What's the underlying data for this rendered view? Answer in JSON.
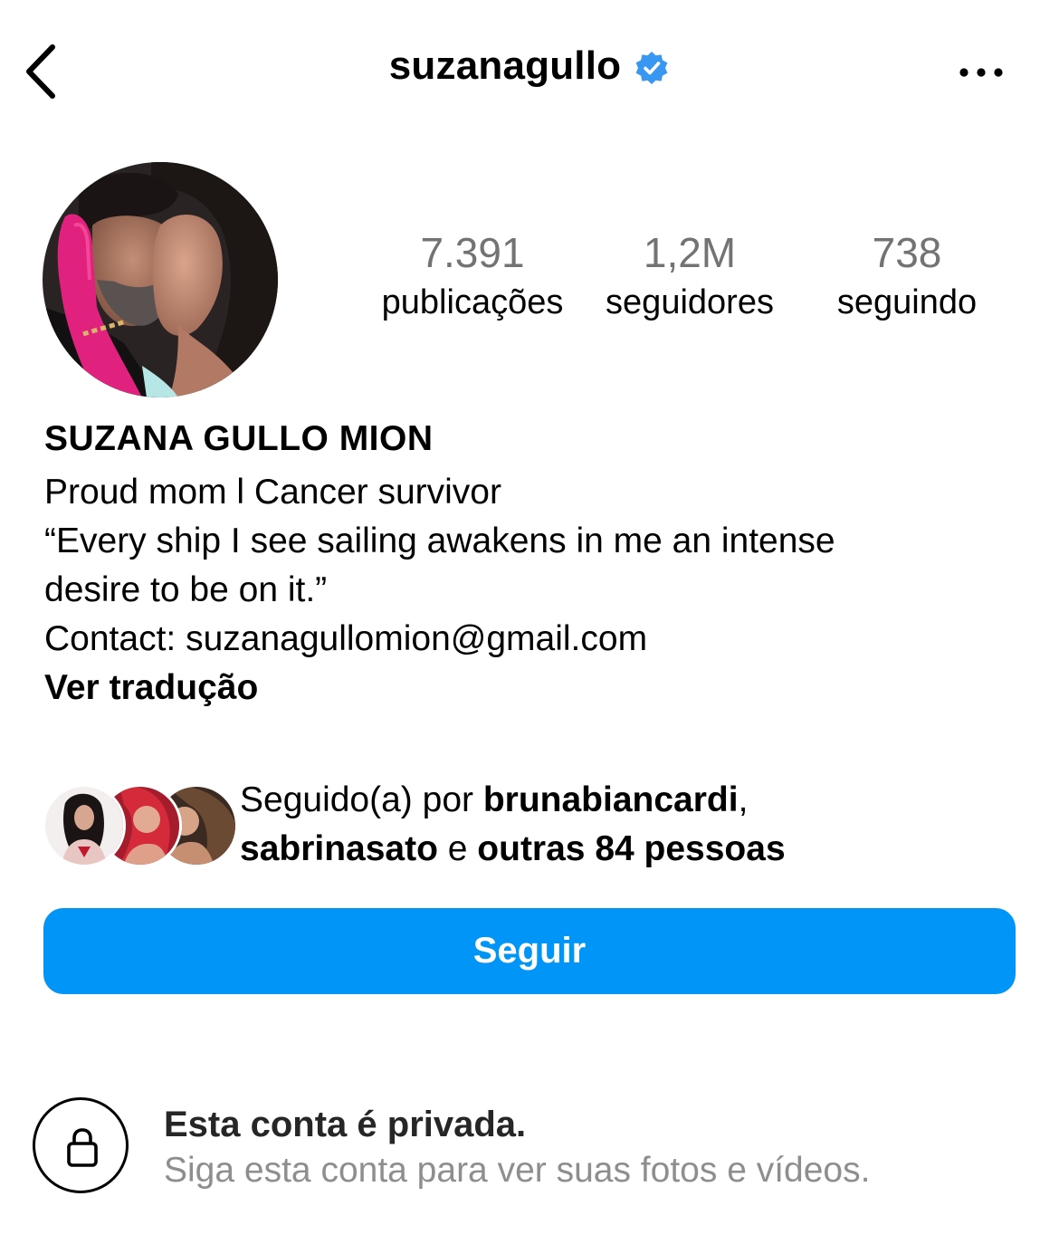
{
  "header": {
    "username": "suzanagullo",
    "verified": true,
    "back_icon": "chevron-left-icon",
    "more_icon": "more-horizontal-icon"
  },
  "stats": {
    "posts_count": "7.391",
    "posts_label": "publicações",
    "followers_count": "1,2M",
    "followers_label": "seguidores",
    "following_count": "738",
    "following_label": "seguindo"
  },
  "bio": {
    "display_name": "SUZANA GULLO MION",
    "lines": [
      "Proud mom l Cancer survivor",
      "“Every ship I see sailing awakens in me an intense",
      "desire to be on it.”",
      "Contact: suzanagullomion@gmail.com"
    ],
    "translate_label": "Ver tradução"
  },
  "followed_by": {
    "prefix": "Seguido(a) por ",
    "user1": "brunabiancardi",
    "separator": ",",
    "user2": "sabrinasato",
    "conjunction": " e ",
    "others": "outras 84 pessoas"
  },
  "follow_button": {
    "label": "Seguir"
  },
  "private_notice": {
    "title": "Esta conta é privada.",
    "subtitle": "Siga esta conta para ver suas fotos e vídeos.",
    "icon": "lock-icon"
  },
  "colors": {
    "accent": "#0095f6",
    "verified_badge": "#3897f0",
    "muted_text": "#8e8e8e",
    "stat_number": "#737373"
  }
}
